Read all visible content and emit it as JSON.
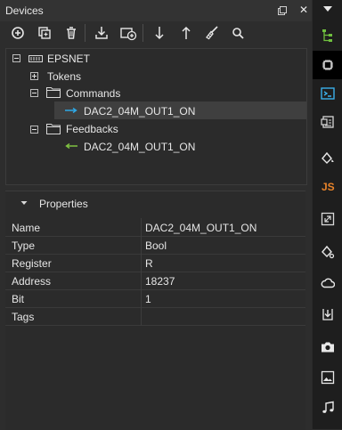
{
  "panel": {
    "title": "Devices",
    "pin_symbol": "⊡",
    "close_symbol": "✕"
  },
  "toolbar": {
    "buttons": [
      "add-icon",
      "duplicate-icon",
      "delete-icon",
      "import-icon",
      "add-device-icon",
      "move-down-icon",
      "move-up-icon",
      "broom-icon",
      "search-icon"
    ]
  },
  "tree": {
    "root": "EPSNET",
    "tokens": "Tokens",
    "commands": "Commands",
    "command_item": "DAC2_04M_OUT1_ON",
    "feedbacks": "Feedbacks",
    "feedback_item": "DAC2_04M_OUT1_ON",
    "command_arrow_color": "#2ea8e6",
    "feedback_arrow_color": "#7fc241"
  },
  "properties": {
    "title": "Properties",
    "rows": [
      {
        "name": "Name",
        "value": "DAC2_04M_OUT1_ON"
      },
      {
        "name": "Type",
        "value": "Bool"
      },
      {
        "name": "Register",
        "value": "R"
      },
      {
        "name": "Address",
        "value": "18237"
      },
      {
        "name": "Bit",
        "value": "1"
      },
      {
        "name": "Tags",
        "value": ""
      }
    ]
  },
  "dock": {
    "items": [
      "tree-icon",
      "chip-icon",
      "terminal-icon",
      "report-icon",
      "bucket-icon",
      "js-icon",
      "resize-icon",
      "bucket-gear-icon",
      "cloud-icon",
      "download-icon",
      "camera-icon",
      "image-icon",
      "music-icon"
    ],
    "js_label": "JS",
    "accent_green": "#6fbf3e",
    "accent_orange": "#e8832a"
  }
}
